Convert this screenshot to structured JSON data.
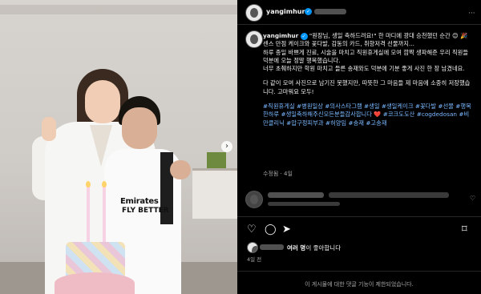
{
  "post": {
    "username": "yangimhur",
    "caption_lines": [
      "\"원장님, 생일 축하드려요!\" 한 마디에 광대 승천했던 순간 😊 🎉",
      "센스 만점 케이크와 꽃다발, 감동의 카드, 취향저격 선물까지...",
      "하루 종일 바쁘게 진료, 시술을 마치고 직원휴게실에 모여 깜짝 생파해준 우리 직원들 덕분에 오늘 정말 행복했습니다.",
      "너무 초췌하지만 학원 마치고 들른 송재와도 덕분에 기분 좋게 사진 한 장 남겼네요.",
      "다 같이 모여 사진으로 남기진 못했지만, 따뜻한 그 마음들 제 마음에 소중히 저장했습니다. 고마워요 모두!"
    ],
    "hashtags": "#직원휴게실 #병원일상 #의사스타그램 #생일 #생일케이크 #꽃다발 #선물 #행복한하루 #생일축하해주신모든분들감사합니다 ❤️ #코크도도산 #cogdedosan #비만클리닉 #압구정피부과 #허양임 #송재 #고송재",
    "meta": "수정됨 · 4일",
    "likes_label": "여러 명",
    "likes_suffix": "이 좋아합니다",
    "date": "4일 전",
    "comments_limited": "이 게시물에 대한 댓글 기능이 제한되었습니다."
  },
  "icons": {
    "like": "heart-icon",
    "comment": "comment-icon",
    "share": "send-icon",
    "save": "bookmark-icon",
    "next": "chevron-right-icon"
  },
  "photo": {
    "shirt_text_1": "Emirates",
    "shirt_text_2": "FLY BETTER"
  },
  "colors": {
    "background": "#000000",
    "text": "#f5f5f5",
    "secondary_text": "#a8a8a8",
    "hashtag": "#79b8ff",
    "verified": "#0095f6"
  }
}
